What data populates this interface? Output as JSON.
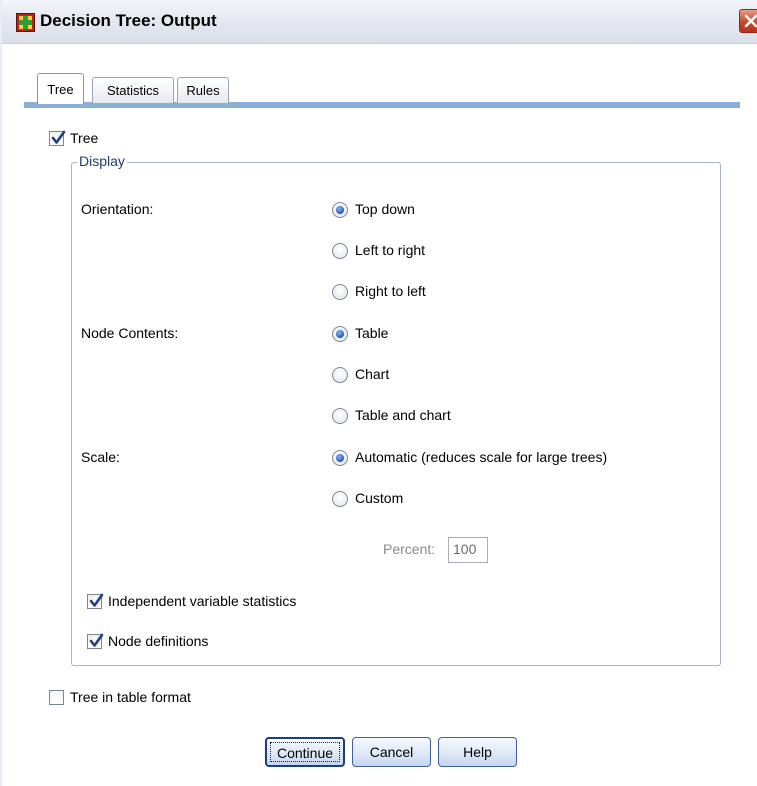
{
  "window": {
    "title": "Decision Tree: Output"
  },
  "tabs": [
    {
      "label": "Tree",
      "active": true
    },
    {
      "label": "Statistics",
      "active": false
    },
    {
      "label": "Rules",
      "active": false
    }
  ],
  "tree_checkbox": {
    "label": "Tree",
    "checked": true
  },
  "display": {
    "group_title": "Display",
    "orientation": {
      "label": "Orientation:",
      "options": [
        {
          "label": "Top down",
          "selected": true
        },
        {
          "label": "Left to right",
          "selected": false
        },
        {
          "label": "Right to left",
          "selected": false
        }
      ]
    },
    "node_contents": {
      "label": "Node Contents:",
      "options": [
        {
          "label": "Table",
          "selected": true
        },
        {
          "label": "Chart",
          "selected": false
        },
        {
          "label": "Table and chart",
          "selected": false
        }
      ]
    },
    "scale": {
      "label": "Scale:",
      "options": [
        {
          "label": "Automatic (reduces scale for large trees)",
          "selected": true
        },
        {
          "label": "Custom",
          "selected": false
        }
      ],
      "percent_label": "Percent:",
      "percent_value": "100"
    },
    "independent_variable_statistics": {
      "label": "Independent variable statistics",
      "checked": true
    },
    "node_definitions": {
      "label": "Node definitions",
      "checked": true
    }
  },
  "tree_in_table_format": {
    "label": "Tree in table format",
    "checked": false
  },
  "buttons": {
    "continue": "Continue",
    "cancel": "Cancel",
    "help": "Help"
  },
  "colors": {
    "tab_accent": "#8ab0d8",
    "radio_selected": "#1d56c5",
    "checkmark": "#1f3f86",
    "close_button": "#c6482c"
  }
}
